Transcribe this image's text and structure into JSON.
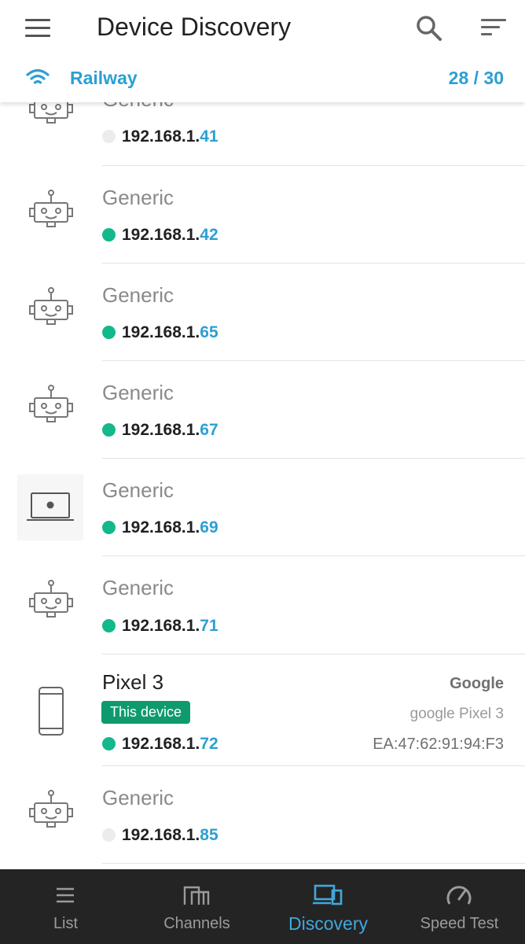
{
  "app": {
    "title": "Device Discovery",
    "network_name": "Railway",
    "device_count": "28 / 30",
    "accent_color": "#2c9fd3",
    "online_color": "#13b88b"
  },
  "devices": [
    {
      "name": "Generic",
      "ip_prefix": "192.168.1.",
      "ip_suffix": "41",
      "status": "offline",
      "icon": "robot-icon"
    },
    {
      "name": "Generic",
      "ip_prefix": "192.168.1.",
      "ip_suffix": "42",
      "status": "online",
      "icon": "robot-icon"
    },
    {
      "name": "Generic",
      "ip_prefix": "192.168.1.",
      "ip_suffix": "65",
      "status": "online",
      "icon": "robot-icon"
    },
    {
      "name": "Generic",
      "ip_prefix": "192.168.1.",
      "ip_suffix": "67",
      "status": "online",
      "icon": "robot-icon"
    },
    {
      "name": "Generic",
      "ip_prefix": "192.168.1.",
      "ip_suffix": "69",
      "status": "online",
      "icon": "laptop-icon"
    },
    {
      "name": "Generic",
      "ip_prefix": "192.168.1.",
      "ip_suffix": "71",
      "status": "online",
      "icon": "robot-icon"
    },
    {
      "name": "Pixel 3",
      "ip_prefix": "192.168.1.",
      "ip_suffix": "72",
      "status": "online",
      "icon": "phone-icon",
      "badge": "This device",
      "vendor": "Google",
      "model": "google Pixel 3",
      "mac": "EA:47:62:91:94:F3"
    },
    {
      "name": "Generic",
      "ip_prefix": "192.168.1.",
      "ip_suffix": "85",
      "status": "offline",
      "icon": "robot-icon"
    }
  ],
  "bottom_nav": [
    {
      "label": "List",
      "icon": "list-icon",
      "active": false
    },
    {
      "label": "Channels",
      "icon": "channels-icon",
      "active": false
    },
    {
      "label": "Discovery",
      "icon": "discovery-icon",
      "active": true
    },
    {
      "label": "Speed Test",
      "icon": "speedometer-icon",
      "active": false
    }
  ]
}
